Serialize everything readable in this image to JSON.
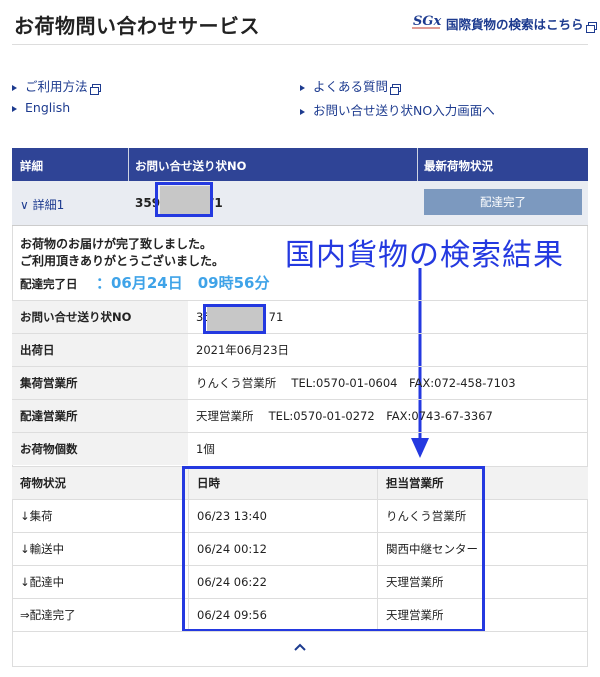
{
  "header": {
    "title": "お荷物問い合わせサービス",
    "intl_link": "国際貨物の検索はこちら"
  },
  "nav": {
    "usage": "ご利用方法",
    "faq": "よくある質問",
    "english": "English",
    "input_screen": "お問い合せ送り状NO入力画面へ"
  },
  "table_header": {
    "col_detail": "詳細",
    "col_tracking": "お問い合せ送り状NO",
    "col_status": "最新荷物状況"
  },
  "summary_row": {
    "detail_label": "詳細1",
    "tracking_prefix": "359",
    "tracking_suffix": "71",
    "status_button": "配達完了"
  },
  "message": {
    "line1": "お荷物のお届けが完了致しました。",
    "line2": "ご利用頂きありがとうございました。",
    "delivered_label": "配達完了日",
    "delivered_value": "：06月24日　09時56分"
  },
  "annotation": "国内貨物の検索結果",
  "info": [
    {
      "label": "お問い合せ送り状NO",
      "value_prefix": "35",
      "value_suffix": "71"
    },
    {
      "label": "出荷日",
      "value": "2021年06月23日"
    },
    {
      "label": "集荷営業所",
      "value": "りんくう営業所　 TEL:0570-01-0604　FAX:072-458-7103"
    },
    {
      "label": "配達営業所",
      "value": "天理営業所　 TEL:0570-01-0272　FAX:0743-67-3367"
    },
    {
      "label": "お荷物個数",
      "value": "1個"
    }
  ],
  "history": {
    "headers": [
      "荷物状況",
      "日時",
      "担当営業所"
    ],
    "rows": [
      [
        "↓集荷",
        "06/23 13:40",
        "りんくう営業所"
      ],
      [
        "↓輸送中",
        "06/24 00:12",
        "関西中継センター"
      ],
      [
        "↓配達中",
        "06/24 06:22",
        "天理営業所"
      ],
      [
        "⇒配達完了",
        "06/24 09:56",
        "天理営業所"
      ]
    ]
  },
  "colors": {
    "header_bg": "#2f4496",
    "annotation_blue": "#2439e0",
    "status_button": "#7c99bf",
    "delivered_time": "#3fa3e8"
  }
}
